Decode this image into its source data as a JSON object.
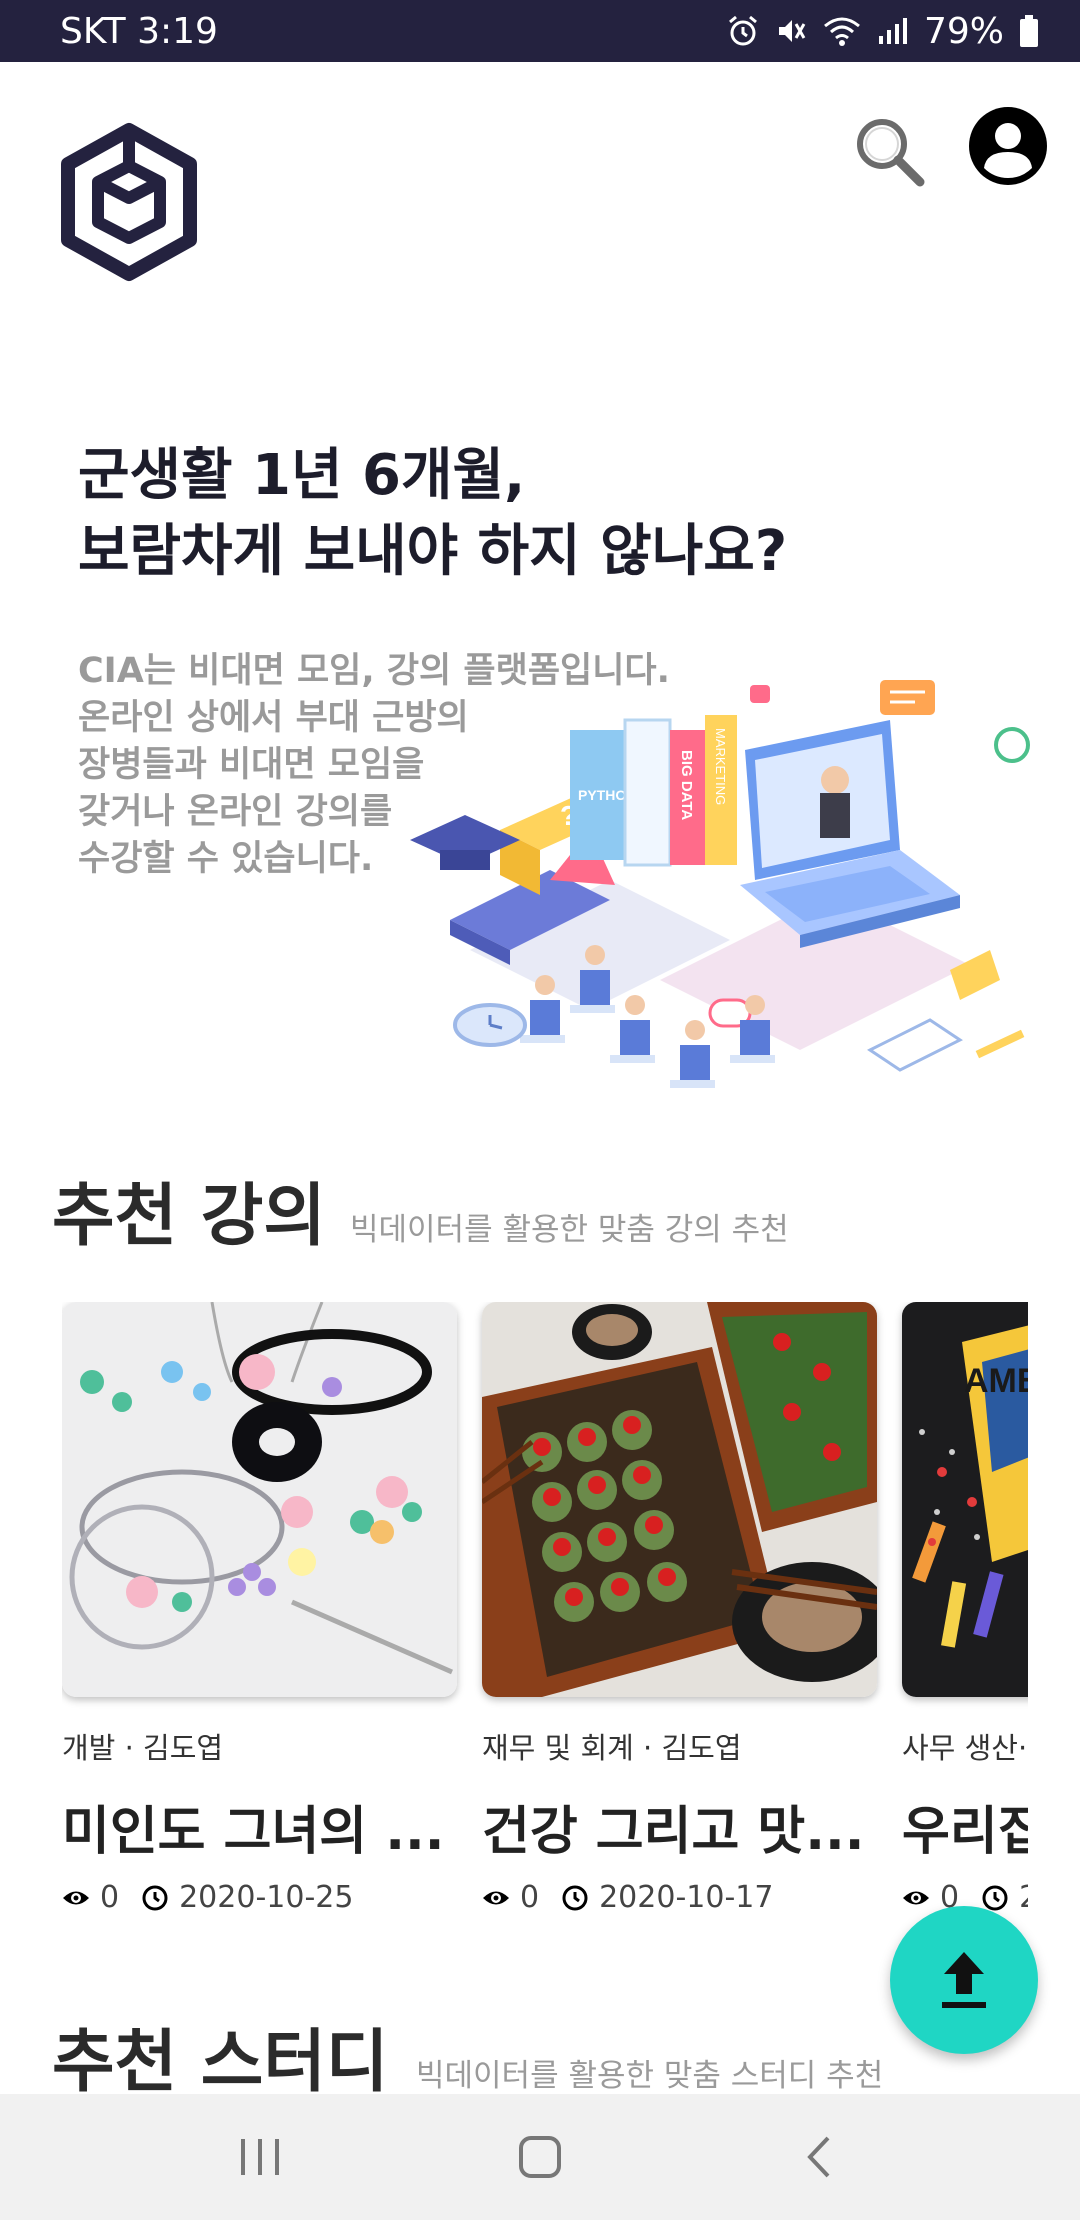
{
  "status_bar": {
    "carrier_time": "SKT 3:19",
    "battery": "79%",
    "icons": [
      "alarm-icon",
      "mute-icon",
      "wifi-icon",
      "signal-icon",
      "battery-icon"
    ]
  },
  "header": {
    "logo_icon": "hex-box-logo",
    "search_icon": "search-icon",
    "profile_icon": "profile-icon"
  },
  "hero": {
    "title_line1": "군생활 1년 6개월,",
    "title_line2": "보람차게 보내야 하지 않나요?",
    "desc_lines": [
      "CIA는 비대면 모임, 강의 플랫폼입니다.",
      "온라인 상에서 부대 근방의",
      "장병들과 비대면 모임을",
      "갖거나 온라인 강의를",
      "수강할 수 있습니다."
    ],
    "illustration_texts": {
      "book1": "PYTHON A-Z",
      "book2": "BIG DATA",
      "book3": "MARKETING"
    }
  },
  "lectures": {
    "title": "추천 강의",
    "subtitle": "빅데이터를 활용한 맞춤 강의 추천",
    "cards": [
      {
        "meta": "개발 · 김도엽",
        "title": "미인도 그녀의 ...",
        "views": "0",
        "date": "2020-10-25"
      },
      {
        "meta": "재무 및 회계 · 김도엽",
        "title": "건강 그리고 맛...",
        "views": "0",
        "date": "2020-10-17"
      },
      {
        "meta": "사무 생산·",
        "title": "우리집",
        "views": "0",
        "date": "2",
        "thumb_text": "AMB"
      }
    ]
  },
  "studies": {
    "title": "추천 스터디",
    "subtitle": "빅데이터를 활용한 맞춤 스터디 추천"
  },
  "fab": {
    "icon": "upload-arrow-icon"
  },
  "nav": {
    "icons": [
      "recents-icon",
      "home-icon",
      "back-icon"
    ]
  },
  "colors": {
    "status_bar": "#24223f",
    "accent": "#1fd6c4",
    "text_dark": "#1d1d2b",
    "text_muted": "#9a9a9a"
  }
}
